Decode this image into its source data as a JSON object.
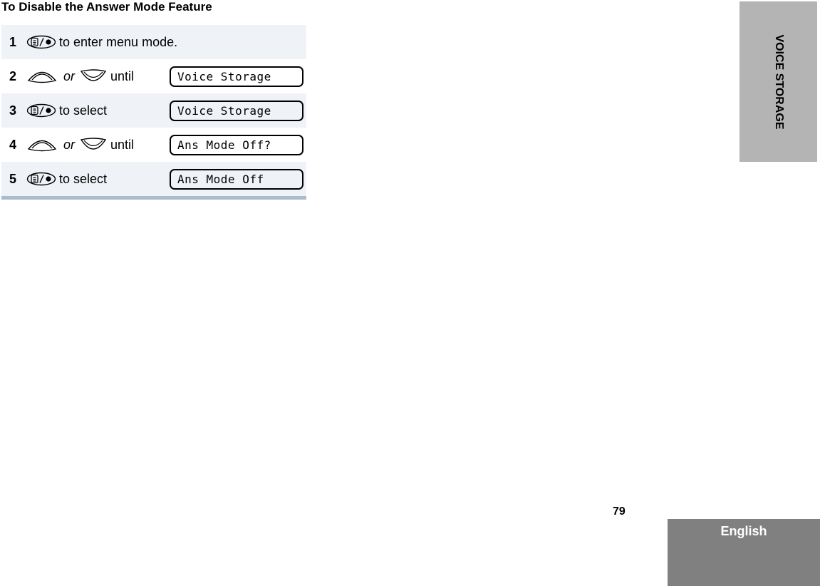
{
  "heading": "To Disable the Answer Mode Feature",
  "steps": [
    {
      "number": "1",
      "icon": "menu-select-button-icon",
      "text": "to enter menu mode.",
      "display": null
    },
    {
      "number": "2",
      "icon": "scroll-up-down-buttons",
      "or": "or",
      "text": "until",
      "display": "Voice Storage"
    },
    {
      "number": "3",
      "icon": "menu-select-button-icon",
      "text": "to select",
      "display": "Voice Storage"
    },
    {
      "number": "4",
      "icon": "scroll-up-down-buttons",
      "or": "or",
      "text": "until",
      "display": "Ans Mode Off?"
    },
    {
      "number": "5",
      "icon": "menu-select-button-icon",
      "text": "to select",
      "display": "Ans Mode Off"
    }
  ],
  "side_tab": "VOICE STORAGE",
  "page_number": "79",
  "language_tab": "English",
  "colors": {
    "row_shade": "#eff3f7",
    "bottom_bar": "#a9bccd",
    "side_tab": "#b4b4b4",
    "language_tab": "#808080"
  }
}
